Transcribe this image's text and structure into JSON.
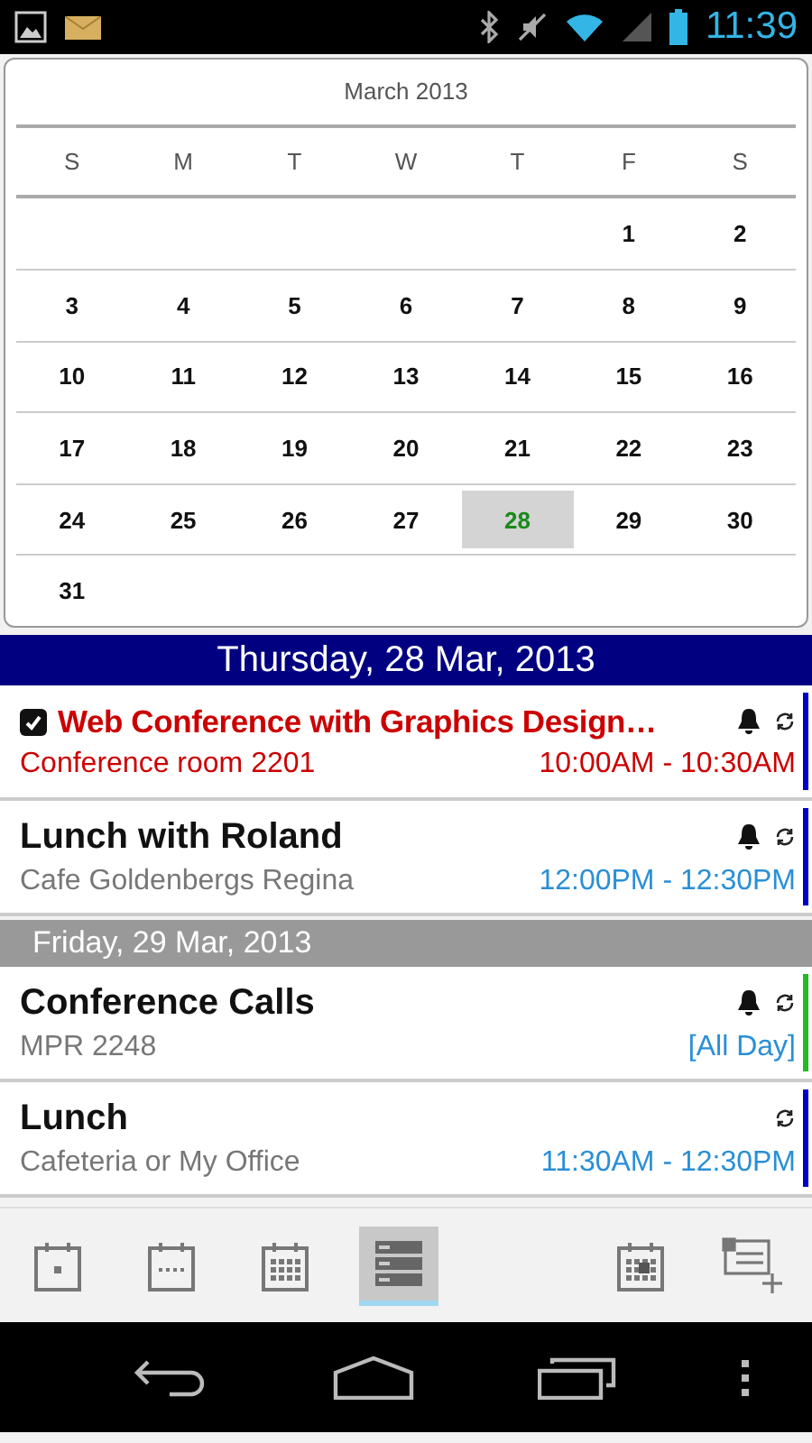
{
  "status_bar": {
    "time": "11:39"
  },
  "calendar": {
    "title": "March 2013",
    "weekdays": [
      "S",
      "M",
      "T",
      "W",
      "T",
      "F",
      "S"
    ],
    "weeks": [
      [
        {
          "label": "1",
          "selected": false
        },
        {
          "label": "2",
          "selected": false
        }
      ],
      [
        {
          "label": "3",
          "selected": false
        },
        {
          "label": "4",
          "selected": false
        },
        {
          "label": "5",
          "selected": false
        },
        {
          "label": "6",
          "selected": false
        },
        {
          "label": "7",
          "selected": false
        },
        {
          "label": "8",
          "selected": false
        },
        {
          "label": "9",
          "selected": false
        }
      ],
      [
        {
          "label": "10",
          "selected": false
        },
        {
          "label": "11",
          "selected": false
        },
        {
          "label": "12",
          "selected": false
        },
        {
          "label": "13",
          "selected": false
        },
        {
          "label": "14",
          "selected": false
        },
        {
          "label": "15",
          "selected": false
        },
        {
          "label": "16",
          "selected": false
        }
      ],
      [
        {
          "label": "17",
          "selected": false
        },
        {
          "label": "18",
          "selected": false
        },
        {
          "label": "19",
          "selected": false
        },
        {
          "label": "20",
          "selected": false
        },
        {
          "label": "21",
          "selected": false
        },
        {
          "label": "22",
          "selected": false
        },
        {
          "label": "23",
          "selected": false
        }
      ],
      [
        {
          "label": "24",
          "selected": false
        },
        {
          "label": "25",
          "selected": false
        },
        {
          "label": "26",
          "selected": false
        },
        {
          "label": "27",
          "selected": false
        },
        {
          "label": "28",
          "selected": true
        },
        {
          "label": "29",
          "selected": false
        },
        {
          "label": "30",
          "selected": false
        }
      ],
      [
        {
          "label": "31",
          "selected": false
        }
      ]
    ]
  },
  "agenda": [
    {
      "header": "Thursday, 28 Mar, 2013",
      "kind": "today",
      "events": [
        {
          "kind": "task",
          "checked": true,
          "overdue": true,
          "title": "Web Conference with Graphics Design…",
          "location": "Conference room 2201",
          "time": "10:00AM - 10:30AM",
          "alarm": true,
          "recurring": true,
          "color": "#0000cc"
        },
        {
          "kind": "event",
          "overdue": false,
          "title": "Lunch with Roland",
          "location": "Cafe Goldenbergs Regina",
          "time": "12:00PM - 12:30PM",
          "alarm": true,
          "recurring": true,
          "color": "#0000cc"
        }
      ]
    },
    {
      "header": "Friday, 29 Mar, 2013",
      "kind": "other",
      "events": [
        {
          "kind": "event",
          "overdue": false,
          "title": "Conference Calls",
          "location": "MPR 2248",
          "time": "[All Day]",
          "alarm": true,
          "recurring": true,
          "color": "#22bb22"
        },
        {
          "kind": "event",
          "overdue": false,
          "title": "Lunch",
          "location": "Cafeteria or My Office",
          "time": "11:30AM - 12:30PM",
          "alarm": false,
          "recurring": true,
          "color": "#0000cc"
        }
      ]
    }
  ],
  "toolbar": {
    "views": [
      {
        "kind": "day",
        "selected": false
      },
      {
        "kind": "week",
        "selected": false
      },
      {
        "kind": "month",
        "selected": false
      },
      {
        "kind": "agenda",
        "selected": true
      }
    ],
    "actions": [
      {
        "kind": "goto-date"
      },
      {
        "kind": "new-event"
      }
    ]
  }
}
